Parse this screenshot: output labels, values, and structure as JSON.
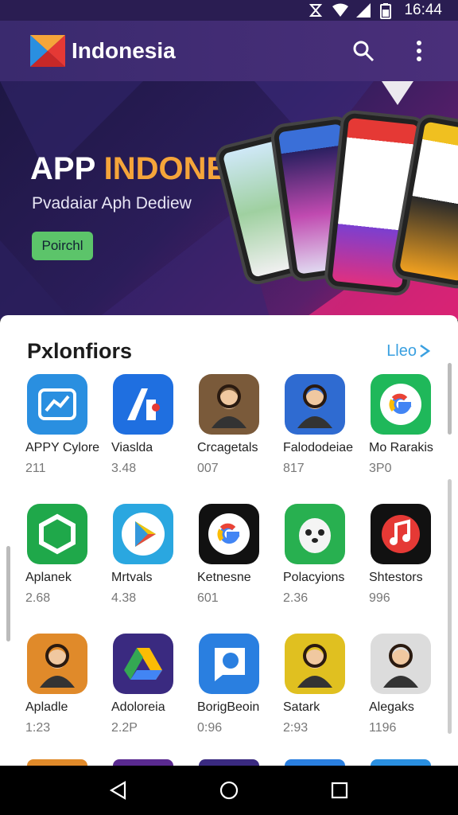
{
  "status_bar": {
    "time": "16:44"
  },
  "app_bar": {
    "title": "Indonesia"
  },
  "hero": {
    "title_part1": "APP ",
    "title_accent": "INDONESIA",
    "subtitle": "Pvadaiar Aph Dediew",
    "button_label": "Poirchl"
  },
  "section": {
    "title": "Pxlonfiors",
    "see_more": "Lleo"
  },
  "apps": [
    {
      "name": "APPY Cylore",
      "value": "211",
      "color": "#2a8fe0",
      "icon": "chart-icon"
    },
    {
      "name": "Viaslda",
      "value": "3.48",
      "color": "#1f6fe0",
      "icon": "letter-a-icon"
    },
    {
      "name": "Crcagetals",
      "value": "007",
      "color": "#7a5a3a",
      "icon": "portrait-icon"
    },
    {
      "name": "Falododeiae",
      "value": "817",
      "color": "#2f6bd1",
      "icon": "portrait-icon"
    },
    {
      "name": "Mo Rarakis",
      "value": "3P0",
      "color": "#1fb85a",
      "icon": "google-icon"
    },
    {
      "name": "Aplanek",
      "value": "2.68",
      "color": "#1fa84a",
      "icon": "hexagon-icon"
    },
    {
      "name": "Mrtvals",
      "value": "4.38",
      "color": "#2aa7e0",
      "icon": "play-icon"
    },
    {
      "name": "Ketnesne",
      "value": "601",
      "color": "#111111",
      "icon": "google-icon"
    },
    {
      "name": "Polacyions",
      "value": "2.36",
      "color": "#28b050",
      "icon": "animal-icon"
    },
    {
      "name": "Shtestors",
      "value": "996",
      "color": "#111111",
      "icon": "music-icon"
    },
    {
      "name": "Apladle",
      "value": "1:23",
      "color": "#e08a2a",
      "icon": "portrait-icon"
    },
    {
      "name": "Adoloreia",
      "value": "2.2P",
      "color": "#3a2a80",
      "icon": "drive-icon"
    },
    {
      "name": "BorigBeoin",
      "value": "0:96",
      "color": "#2a7fe0",
      "icon": "chat-icon"
    },
    {
      "name": "Satark",
      "value": "2:93",
      "color": "#e0c020",
      "icon": "portrait-icon"
    },
    {
      "name": "Alegaks",
      "value": "1196",
      "color": "#dcdcdc",
      "icon": "portrait-icon"
    }
  ]
}
